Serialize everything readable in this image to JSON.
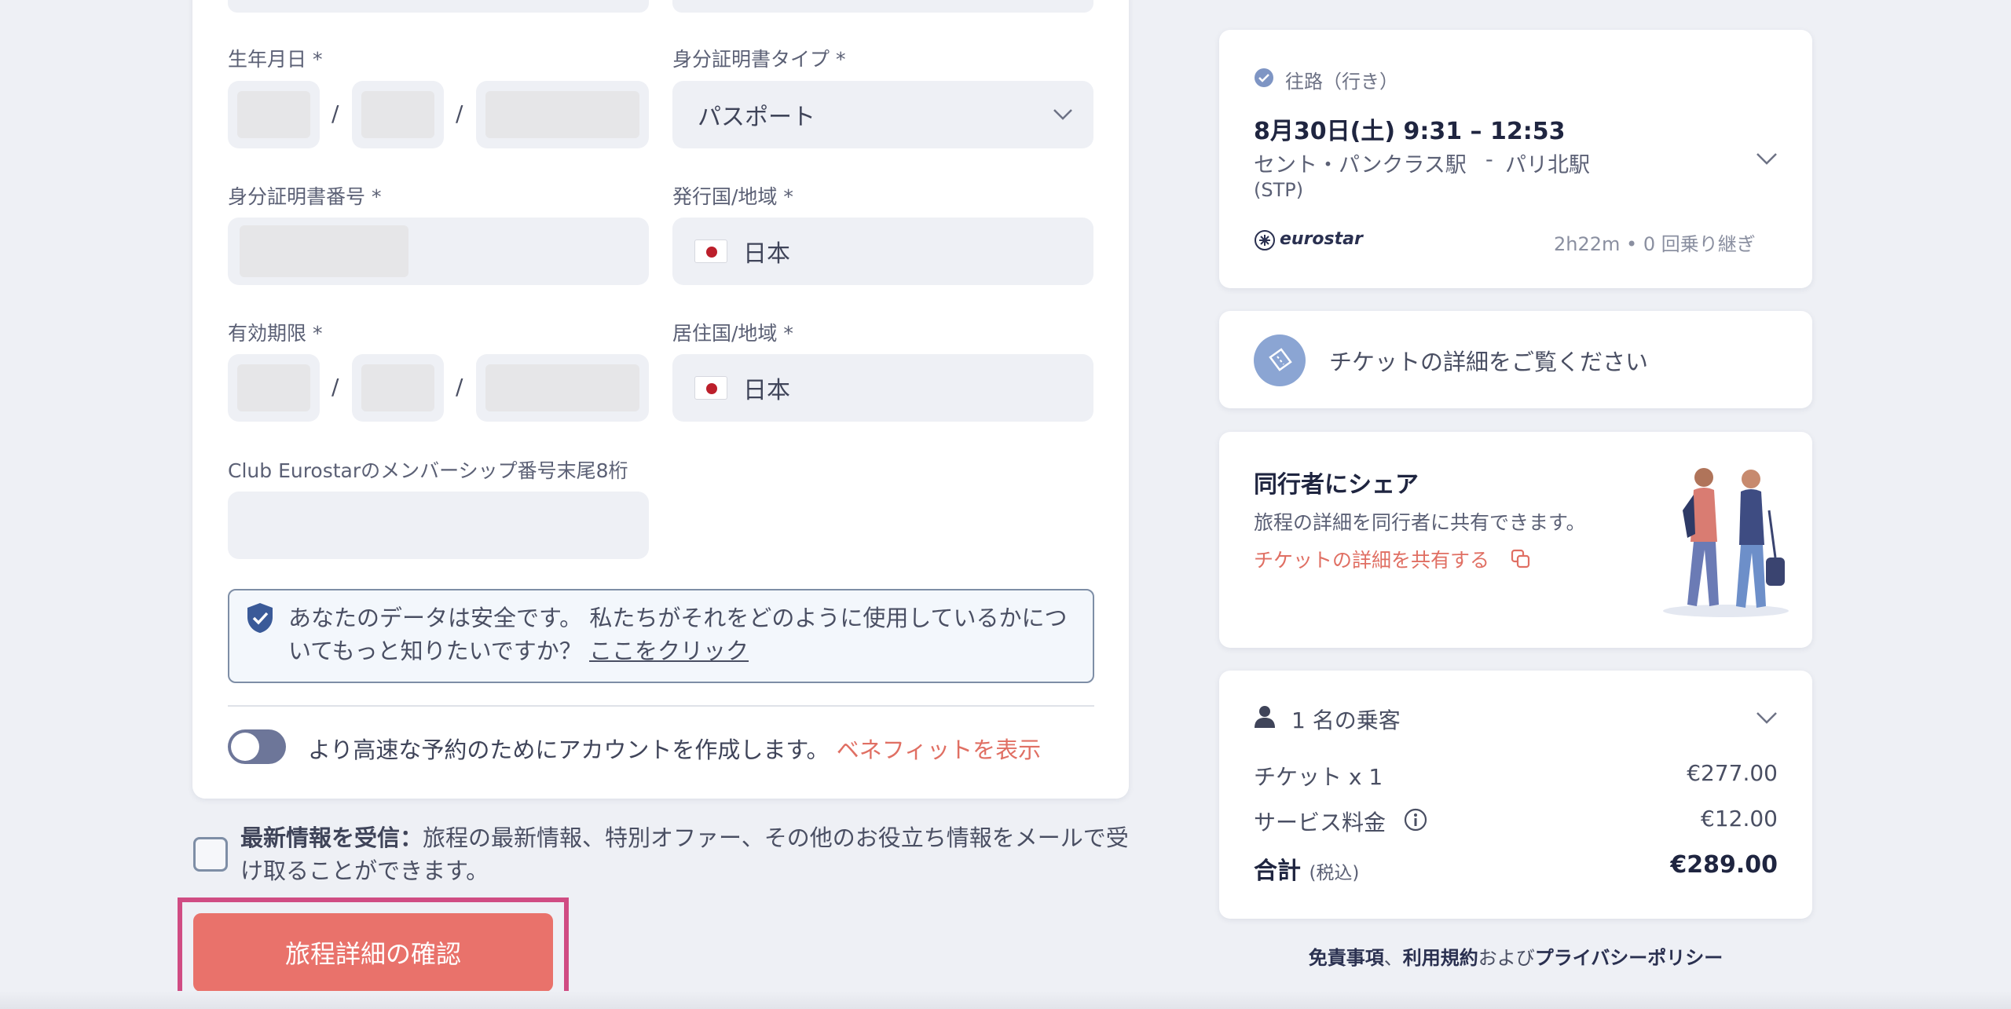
{
  "form": {
    "birth_date_label": "生年月日 *",
    "id_type_label": "身分証明書タイプ *",
    "id_type_value": "パスポート",
    "id_number_label": "身分証明書番号 *",
    "issuing_country_label": "発行国/地域 *",
    "issuing_country_value": "日本",
    "expiry_label": "有効期限 *",
    "residence_label": "居住国/地域 *",
    "residence_value": "日本",
    "membership_label": "Club Eurostarのメンバーシップ番号末尾8桁",
    "date_separator": "/"
  },
  "privacy_notice": {
    "text": "あなたのデータは安全です。 私たちがそれをどのように使用しているかについてもっと知りたいですか？",
    "link": "ここをクリック"
  },
  "account_toggle": {
    "text": "より高速な予約のためにアカウントを作成します。",
    "link": "ベネフィットを表示",
    "on": false
  },
  "newsletter": {
    "bold": "最新情報を受信：",
    "text": "旅程の最新情報、特別オファー、その他のお役立ち情報をメールで受け取ることができます。",
    "checked": false
  },
  "confirm_button": "旅程詳細の確認",
  "journey": {
    "direction_label": "往路（行き）",
    "date_time": "8月30日(土)   9:31 – 12:53",
    "from": "セント・パンクラス駅",
    "dash": "-",
    "to": "パリ北駅",
    "from_code": "(STP)",
    "operator": "eurostar",
    "duration": "2h22m • 0 回乗り継ぎ"
  },
  "ticket_details": "チケットの詳細をご覧ください",
  "share": {
    "title": "同行者にシェア",
    "description": "旅程の詳細を同行者に共有できます。",
    "link": "チケットの詳細を共有する"
  },
  "price": {
    "passengers": "1 名の乗客",
    "ticket_label": "チケット x 1",
    "ticket_value": "€277.00",
    "service_label": "サービス料金",
    "service_value": "€12.00",
    "total_label": "合計",
    "total_tax": "(税込)",
    "total_value": "€289.00"
  },
  "footer": {
    "disclaimer": "免責事項",
    "sep": "、",
    "terms": "利用規約",
    "and": "および",
    "privacy": "プライバシーポリシー"
  },
  "colors": {
    "accent": "#e9726b",
    "link": "#e06f63",
    "highlight": "#d04c83",
    "background": "#eef0f5"
  }
}
